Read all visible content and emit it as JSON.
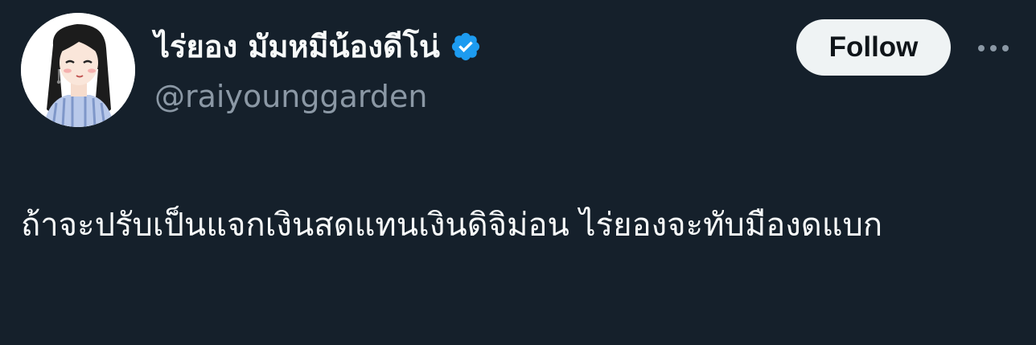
{
  "author": {
    "display_name": "ไร่ยอง มัมหมีน้องดีโน่",
    "handle": "@raiyounggarden",
    "verified": true,
    "avatar_icon": "illustrated-girl-avatar"
  },
  "actions": {
    "follow_label": "Follow",
    "more_icon": "more-horizontal-icon"
  },
  "tweet": {
    "text": "ถ้าจะปรับเป็นแจกเงินสดแทนเงินดิจิม่อน ไร่ยองจะทับมืองดแบก"
  },
  "colors": {
    "background": "#15202b",
    "text_primary": "#f7f9f9",
    "text_secondary": "#8b98a5",
    "verified_blue": "#1d9bf0",
    "follow_bg": "#eff3f4"
  }
}
